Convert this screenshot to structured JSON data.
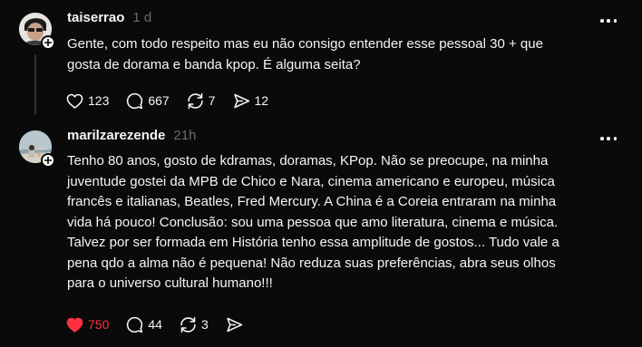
{
  "posts": [
    {
      "username": "taiserrao",
      "time": "1 d",
      "text": "Gente, com todo respeito mas eu não consigo entender esse pessoal 30 + que\ngosta de dorama e banda kpop. É alguma seita?",
      "likes": "123",
      "comments": "667",
      "reposts": "7",
      "shares": "12",
      "liked": false
    },
    {
      "username": "marilzarezende",
      "time": "21h",
      "text": "Tenho 80 anos, gosto de kdramas, doramas, KPop. Não se preocupe, na minha\njuventude gostei da MPB de Chico e Nara, cinema americano e europeu, música\nfrancês e italianas, Beatles, Fred Mercury. A China é a Coreia entraram na minha\nvida há pouco! Conclusão: sou uma pessoa que amo literatura, cinema e música.\nTalvez por ser formada em História tenho essa amplitude de gostos... Tudo vale a\npena qdo a alma não é pequena! Não reduza suas preferências, abra seus olhos\npara o universo cultural humano!!!",
      "likes": "750",
      "comments": "44",
      "reposts": "3",
      "shares": "",
      "liked": true
    }
  ],
  "colors": {
    "background": "#0a0a0a",
    "text": "#f3f5f7",
    "muted": "#6b6b6b",
    "like_active": "#ff3040",
    "thread_line": "#333638"
  },
  "icons": [
    "heart-icon",
    "comment-icon",
    "repost-icon",
    "share-icon",
    "more-icon",
    "plus-icon"
  ]
}
